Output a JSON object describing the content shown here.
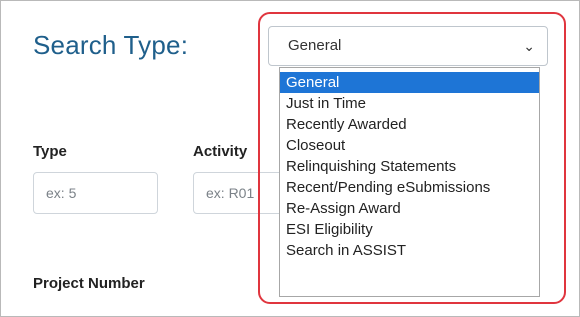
{
  "search": {
    "title": "Search Type:",
    "selected": "General",
    "options": [
      "General",
      "Just in Time",
      "Recently Awarded",
      "Closeout",
      "Relinquishing Statements",
      "Recent/Pending eSubmissions",
      "Re-Assign Award",
      "ESI Eligibility",
      "Search in ASSIST"
    ]
  },
  "fields": {
    "type_label": "Type",
    "type_placeholder": "ex: 5",
    "activity_label": "Activity",
    "activity_placeholder": "ex: R01",
    "project_number_label": "Project Number"
  },
  "colors": {
    "title": "#1f5f8b",
    "selected_option": "#1e75d6",
    "highlight_border": "#e0353e"
  }
}
